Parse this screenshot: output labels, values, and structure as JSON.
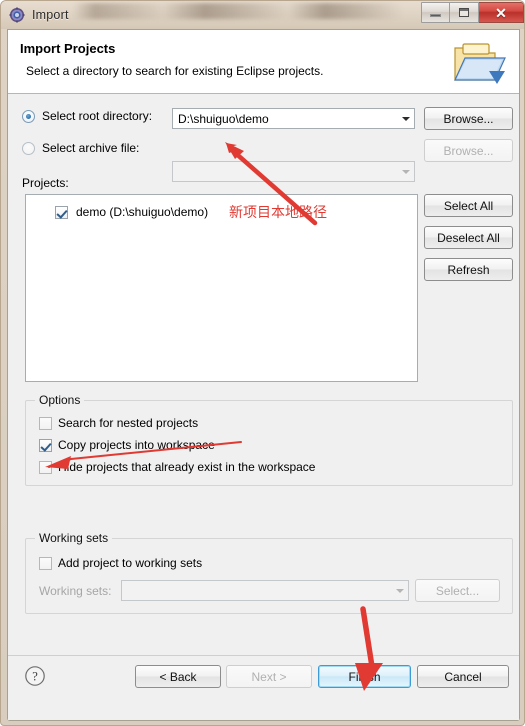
{
  "window": {
    "title": "Import",
    "icon": "eclipse-import-icon",
    "controls": {
      "minimize": "minimize-icon",
      "maximize": "maximize-icon",
      "close": "✕"
    }
  },
  "banner": {
    "title": "Import Projects",
    "description": "Select a directory to search for existing Eclipse projects.",
    "icon": "open-folder-icon"
  },
  "source": {
    "root_directory": {
      "radio_label": "Select root directory:",
      "selected": true,
      "value": "D:\\shuiguo\\demo",
      "browse_label": "Browse...",
      "browse_enabled": true
    },
    "archive_file": {
      "radio_label": "Select archive file:",
      "selected": false,
      "value": "",
      "browse_label": "Browse...",
      "browse_enabled": false
    }
  },
  "projects": {
    "label": "Projects:",
    "items": [
      {
        "checked": true,
        "name": "demo (D:\\shuiguo\\demo)"
      }
    ],
    "buttons": {
      "select_all": "Select All",
      "deselect_all": "Deselect All",
      "refresh": "Refresh"
    }
  },
  "options": {
    "group_title": "Options",
    "checkboxes": [
      {
        "label": "Search for nested projects",
        "checked": false
      },
      {
        "label": "Copy projects into workspace",
        "checked": true
      },
      {
        "label": "Hide projects that already exist in the workspace",
        "checked": false
      }
    ]
  },
  "working_sets": {
    "group_title": "Working sets",
    "add_checkbox": {
      "label": "Add project to working sets",
      "checked": false
    },
    "field_label": "Working sets:",
    "field_value": "",
    "select_label": "Select...",
    "enabled": false
  },
  "footer": {
    "help_icon": "help-question-icon",
    "buttons": [
      {
        "label": "< Back",
        "enabled": true,
        "default": false
      },
      {
        "label": "Next >",
        "enabled": false,
        "default": false
      },
      {
        "label": "Finish",
        "enabled": true,
        "default": true
      },
      {
        "label": "Cancel",
        "enabled": true,
        "default": false
      }
    ]
  },
  "annotations": {
    "color": "#e03a33",
    "note_text": "新项目本地路径",
    "arrows": [
      {
        "name": "arrow-to-root-directory",
        "points_at": "root directory value"
      },
      {
        "name": "arrow-to-copy-projects",
        "points_at": "Copy projects into workspace"
      },
      {
        "name": "arrow-to-finish",
        "points_at": "Finish button"
      }
    ]
  }
}
